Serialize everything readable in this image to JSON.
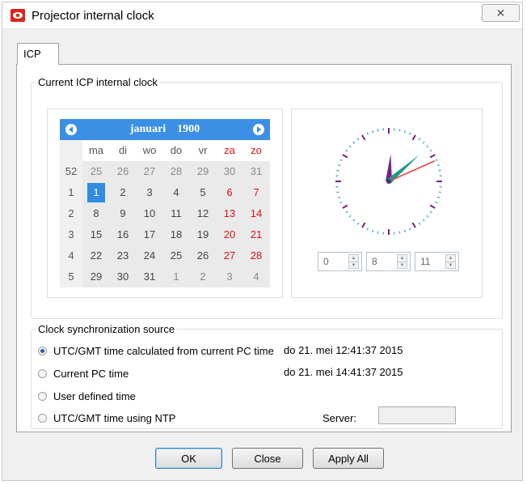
{
  "window": {
    "title": "Projector internal clock",
    "close_glyph": "✕"
  },
  "tabs": [
    {
      "label": "ICP"
    }
  ],
  "internal_clock": {
    "group_title": "Current ICP internal clock",
    "calendar": {
      "month": "januari",
      "year": "1900",
      "weekday_headers": [
        "ma",
        "di",
        "wo",
        "do",
        "vr",
        "za",
        "zo"
      ],
      "weeks": [
        {
          "week": "52",
          "days": [
            "25",
            "26",
            "27",
            "28",
            "29",
            "30",
            "31"
          ]
        },
        {
          "week": "1",
          "days": [
            "1",
            "2",
            "3",
            "4",
            "5",
            "6",
            "7"
          ]
        },
        {
          "week": "2",
          "days": [
            "8",
            "9",
            "10",
            "11",
            "12",
            "13",
            "14"
          ]
        },
        {
          "week": "3",
          "days": [
            "15",
            "16",
            "17",
            "18",
            "19",
            "20",
            "21"
          ]
        },
        {
          "week": "4",
          "days": [
            "22",
            "23",
            "24",
            "25",
            "26",
            "27",
            "28"
          ]
        },
        {
          "week": "5",
          "days": [
            "29",
            "30",
            "31",
            "1",
            "2",
            "3",
            "4"
          ]
        }
      ],
      "selected_day": "1",
      "header_color": "#3b8fe5",
      "weekend_color": "#e0101a"
    },
    "clock": {
      "hours": "0",
      "minutes": "8",
      "seconds": "11",
      "second_hand_color": "#ef4040",
      "minute_hand_color": "#1e9a8a",
      "hour_hand_color": "#7a1f86"
    }
  },
  "sync": {
    "group_title": "Clock synchronization source",
    "options": [
      {
        "label": "UTC/GMT time calculated from current PC time",
        "value": "do 21. mei 12:41:37 2015",
        "checked": true
      },
      {
        "label": "Current PC time",
        "value": "do 21. mei 14:41:37 2015",
        "checked": false
      },
      {
        "label": "User defined time",
        "value": "",
        "checked": false
      },
      {
        "label": "UTC/GMT time using NTP",
        "value": "",
        "checked": false
      }
    ],
    "server_label": "Server:",
    "server_value": ""
  },
  "buttons": {
    "ok": "OK",
    "close": "Close",
    "apply_all": "Apply All"
  }
}
